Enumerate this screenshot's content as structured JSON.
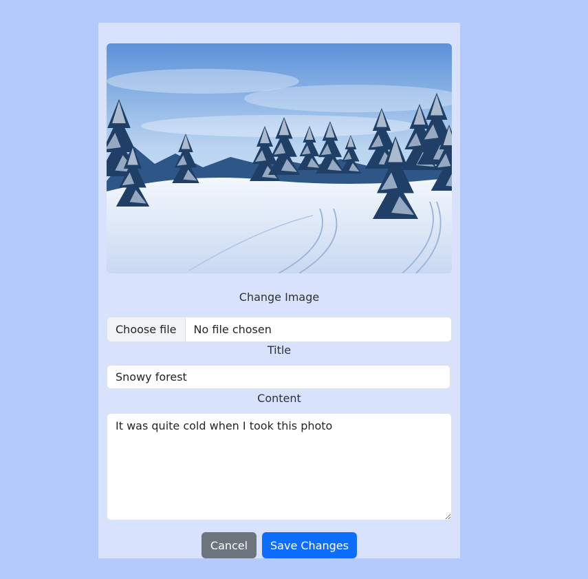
{
  "form": {
    "image_alt": "snowy forest photo",
    "change_image_label": "Change Image",
    "file_button_label": "Choose file",
    "file_status": "No file chosen",
    "title_label": "Title",
    "title_value": "Snowy forest",
    "content_label": "Content",
    "content_value": "It was quite cold when I took this photo",
    "cancel_label": "Cancel",
    "save_label": "Save Changes"
  },
  "colors": {
    "page_background": "#b4c9fc",
    "card_background": "#d8e2fc",
    "cancel_button": "#6c757d",
    "save_button": "#0d6efd"
  }
}
